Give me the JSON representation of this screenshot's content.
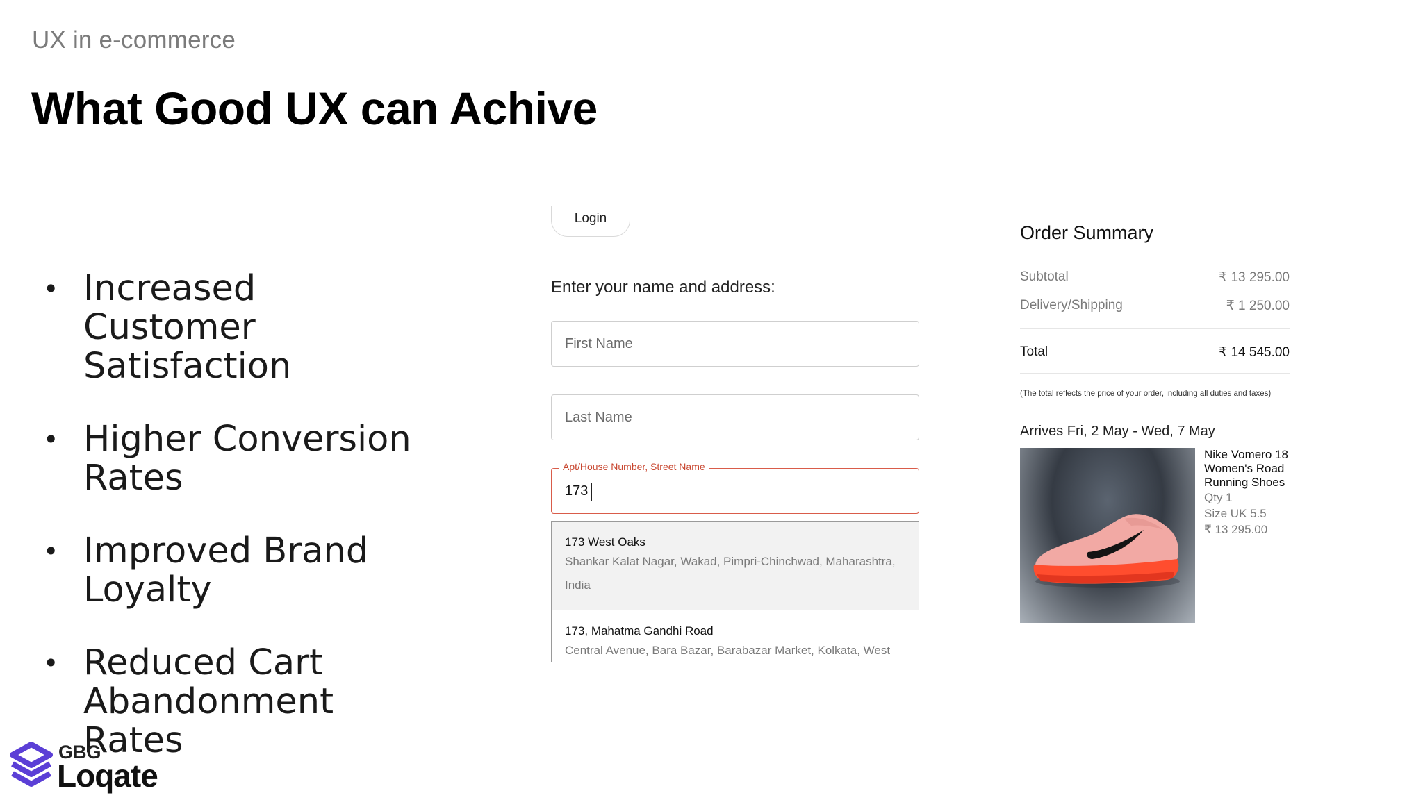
{
  "header": {
    "subtitle": "UX in e-commerce",
    "title": "What Good UX can Achive"
  },
  "bullets": [
    "Increased Customer Satisfaction",
    "Higher Conversion Rates",
    "Improved Brand Loyalty",
    "Reduced Cart Abandonment Rates"
  ],
  "bullet_glyph": "•",
  "logo": {
    "small": "GBG",
    "word": "Loqate",
    "brand_color": "#5b3fd6"
  },
  "form": {
    "login_label": "Login",
    "heading": "Enter your name and address:",
    "first_name_placeholder": "First Name",
    "last_name_placeholder": "Last Name",
    "address_label": "Apt/House Number, Street Name",
    "address_value": "173",
    "accent_color": "#d95c4a",
    "suggestions": [
      {
        "number": "173",
        "street": " West Oaks",
        "detail": "Shankar Kalat Nagar, Wakad, Pimpri-Chinchwad, Maharashtra, India"
      },
      {
        "number": "173",
        "street": ", Mahatma Gandhi Road",
        "detail": "Central Avenue, Bara Bazar, Barabazar Market, Kolkata, West"
      }
    ]
  },
  "order_summary": {
    "title": "Order Summary",
    "subtotal_label": "Subtotal",
    "subtotal_value": "₹ 13 295.00",
    "delivery_label": "Delivery/Shipping",
    "delivery_value": "₹ 1 250.00",
    "total_label": "Total",
    "total_value": "₹ 14 545.00",
    "note": "(The total reflects the price of your order, including all duties and taxes)",
    "arrives": "Arrives Fri, 2 May - Wed, 7 May",
    "product": {
      "name": "Nike Vomero 18 Women's Road Running Shoes",
      "qty": "Qty 1",
      "size": "Size UK 5.5",
      "price": "₹ 13 295.00"
    }
  }
}
